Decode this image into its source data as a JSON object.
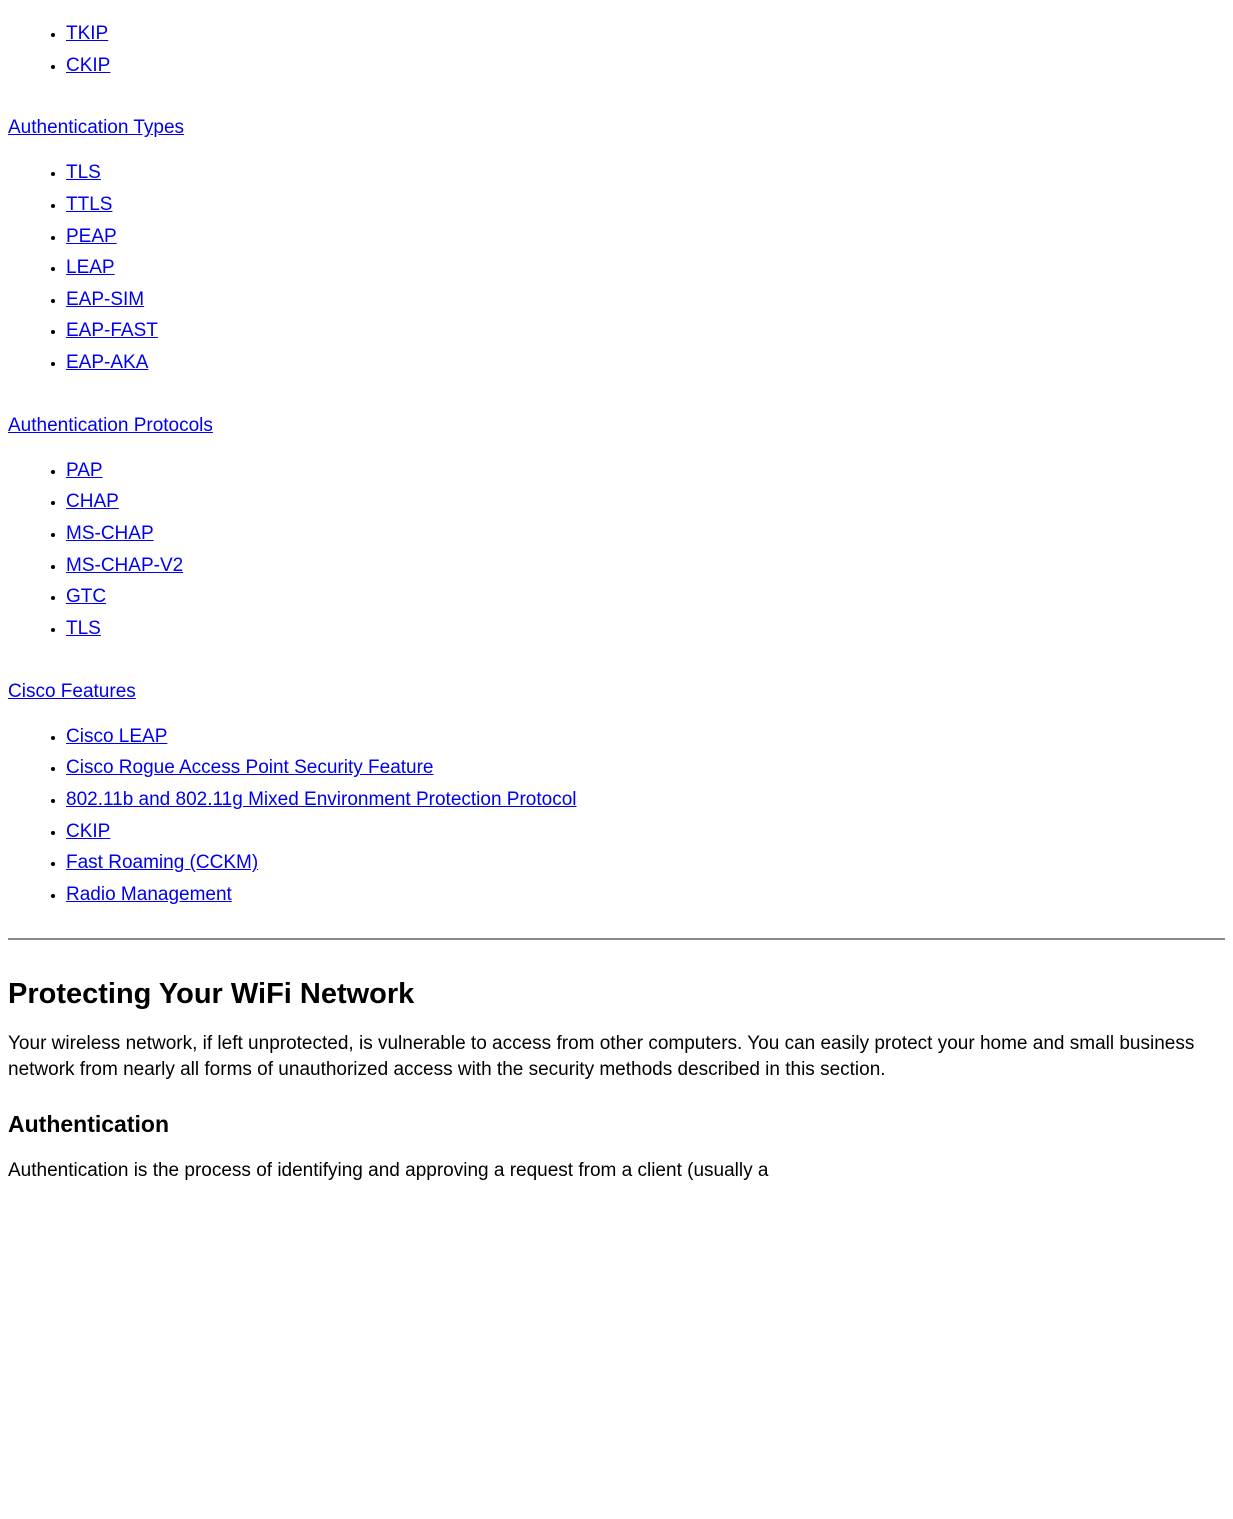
{
  "toc": {
    "group0": {
      "items": [
        "TKIP",
        "CKIP"
      ]
    },
    "group1": {
      "heading": "Authentication Types",
      "items": [
        "TLS",
        "TTLS",
        "PEAP",
        "LEAP",
        "EAP-SIM",
        "EAP-FAST",
        "EAP-AKA"
      ]
    },
    "group2": {
      "heading": "Authentication Protocols",
      "items": [
        "PAP",
        "CHAP",
        "MS-CHAP",
        "MS-CHAP-V2",
        "GTC",
        "TLS"
      ]
    },
    "group3": {
      "heading": "Cisco Features",
      "items": [
        "Cisco LEAP",
        "Cisco Rogue Access Point Security Feature",
        "802.11b and 802.11g Mixed Environment Protection Protocol",
        "CKIP",
        "Fast Roaming (CCKM)",
        "Radio Management"
      ]
    }
  },
  "section1": {
    "heading": "Protecting Your WiFi Network",
    "para": "Your wireless network, if left unprotected, is vulnerable to access from other computers. You can easily protect your home and small business network from nearly all forms of unauthorized access with the security methods described in this section."
  },
  "section2": {
    "heading": "Authentication",
    "para": "Authentication is the process of identifying and approving a request from a client (usually a"
  }
}
